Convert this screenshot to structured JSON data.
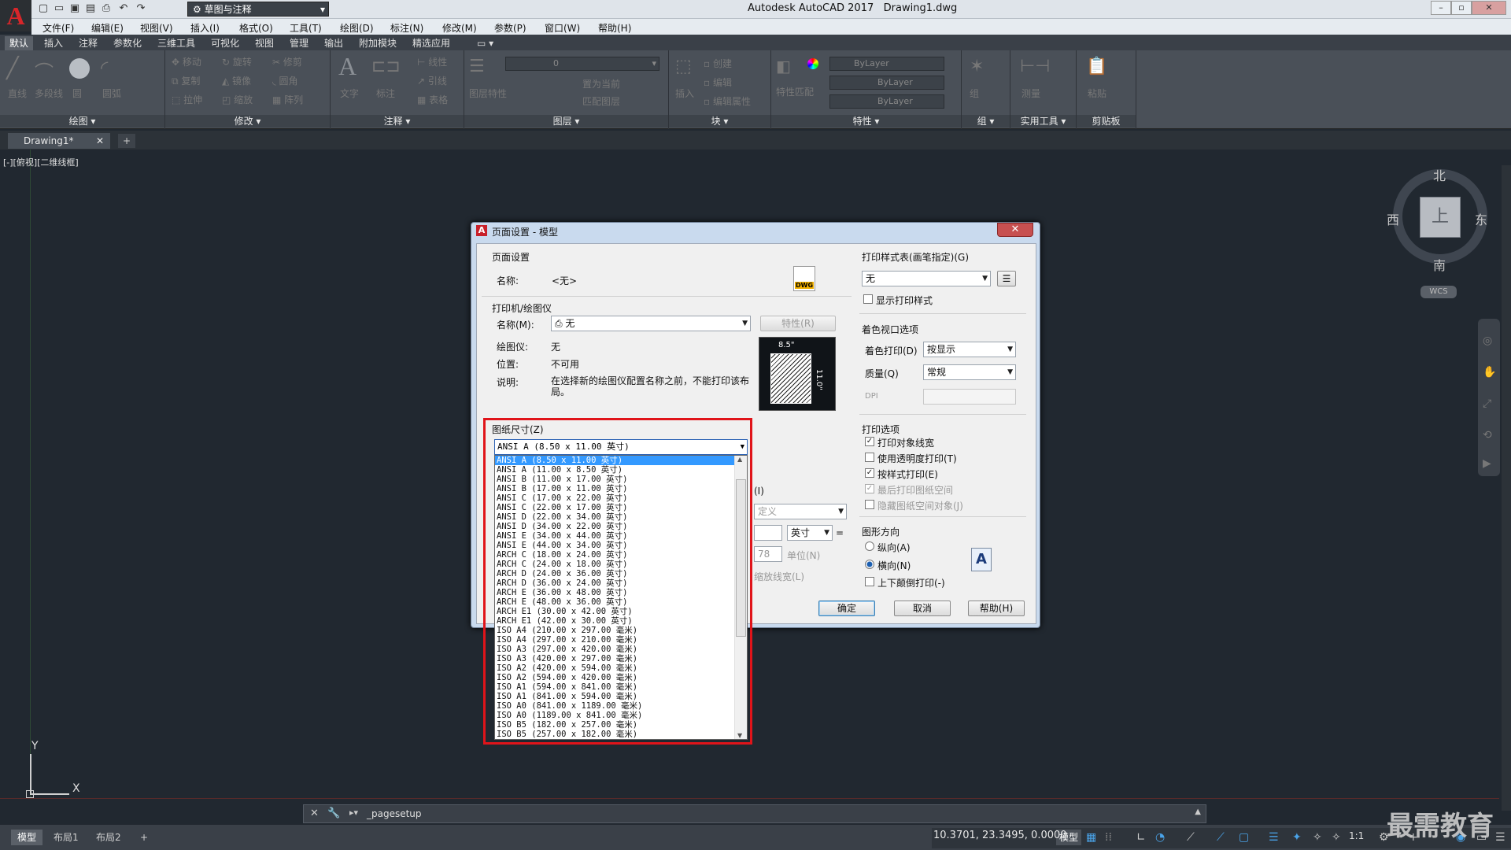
{
  "app": {
    "title": "Autodesk AutoCAD 2017",
    "filename": "Drawing1.dwg",
    "logo": "A",
    "workspace": "草图与注释"
  },
  "menus": [
    "文件(F)",
    "编辑(E)",
    "视图(V)",
    "插入(I)",
    "格式(O)",
    "工具(T)",
    "绘图(D)",
    "标注(N)",
    "修改(M)",
    "参数(P)",
    "窗口(W)",
    "帮助(H)"
  ],
  "ribbon_tabs": [
    "默认",
    "插入",
    "注释",
    "参数化",
    "三维工具",
    "可视化",
    "视图",
    "管理",
    "输出",
    "附加模块",
    "精选应用"
  ],
  "ribbon_groups": {
    "draw": {
      "label": "绘图 ▾",
      "items": [
        "直线",
        "多段线",
        "圆",
        "圆弧"
      ]
    },
    "modify": {
      "label": "修改 ▾",
      "items": [
        "移动",
        "旋转",
        "修剪",
        "复制",
        "镜像",
        "圆角",
        "拉伸",
        "缩放",
        "阵列"
      ]
    },
    "annotation": {
      "label": "注释 ▾",
      "items": [
        "文字",
        "标注",
        "线性",
        "引线",
        "表格"
      ]
    },
    "layers": {
      "label": "图层 ▾",
      "layer_value": "0",
      "items": [
        "图层特性",
        "置为当前",
        "匹配图层"
      ]
    },
    "block": {
      "label": "块 ▾",
      "items": [
        "插入",
        "创建",
        "编辑",
        "编辑属性"
      ]
    },
    "properties": {
      "label": "特性 ▾",
      "bylayer1": "ByLayer",
      "bylayer2": "ByLayer",
      "bylayer3": "ByLayer",
      "items": [
        "特性匹配"
      ]
    },
    "groups": {
      "label": "组 ▾",
      "items": [
        "组"
      ]
    },
    "utilities": {
      "label": "实用工具 ▾",
      "items": [
        "测量"
      ]
    },
    "clipboard": {
      "label": "剪贴板",
      "items": [
        "粘贴"
      ]
    }
  },
  "doc_tab": "Drawing1*",
  "viewport_label": "[-][俯视][二维线框]",
  "viewcube": {
    "north": "北",
    "south": "南",
    "east": "东",
    "west": "西",
    "face": "上",
    "wcs": "WCS"
  },
  "ucs": {
    "x": "X",
    "y": "Y"
  },
  "dialog": {
    "title": "页面设置 - 模型",
    "page_setup": {
      "heading": "页面设置",
      "name_label": "名称:",
      "name_value": "<无>",
      "dwg_icon": "DWG"
    },
    "printer": {
      "heading": "打印机/绘图仪",
      "name_label": "名称(M):",
      "name_value": "无",
      "properties_button": "特性(R)",
      "plotter_label": "绘图仪:",
      "plotter_value": "无",
      "location_label": "位置:",
      "location_value": "不可用",
      "description_label": "说明:",
      "description_value": "在选择新的绘图仪配置名称之前，不能打印该布局。",
      "preview_width": "8.5\"",
      "preview_height": "11.0\""
    },
    "paper_size": {
      "heading": "图纸尺寸(Z)",
      "selected": "ANSI A (8.50 x 11.00 英寸)",
      "options": [
        "ANSI A (8.50 x 11.00 英寸)",
        "ANSI A (11.00 x 8.50 英寸)",
        "ANSI B (11.00 x 17.00 英寸)",
        "ANSI B (17.00 x 11.00 英寸)",
        "ANSI C (17.00 x 22.00 英寸)",
        "ANSI C (22.00 x 17.00 英寸)",
        "ANSI D (22.00 x 34.00 英寸)",
        "ANSI D (34.00 x 22.00 英寸)",
        "ANSI E (34.00 x 44.00 英寸)",
        "ANSI E (44.00 x 34.00 英寸)",
        "ARCH C (18.00 x 24.00 英寸)",
        "ARCH C (24.00 x 18.00 英寸)",
        "ARCH D (24.00 x 36.00 英寸)",
        "ARCH D (36.00 x 24.00 英寸)",
        "ARCH E (36.00 x 48.00 英寸)",
        "ARCH E (48.00 x 36.00 英寸)",
        "ARCH E1 (30.00 x 42.00 英寸)",
        "ARCH E1 (42.00 x 30.00 英寸)",
        "ISO A4 (210.00 x 297.00 毫米)",
        "ISO A4 (297.00 x 210.00 毫米)",
        "ISO A3 (297.00 x 420.00 毫米)",
        "ISO A3 (420.00 x 297.00 毫米)",
        "ISO A2 (420.00 x 594.00 毫米)",
        "ISO A2 (594.00 x 420.00 毫米)",
        "ISO A1 (594.00 x 841.00 毫米)",
        "ISO A1 (841.00 x 594.00 毫米)",
        "ISO A0 (841.00 x 1189.00 毫米)",
        "ISO A0 (1189.00 x 841.00 毫米)",
        "ISO B5 (182.00 x 257.00 毫米)",
        "ISO B5 (257.00 x 182.00 毫米)"
      ]
    },
    "scale": {
      "partial_label": "(I)",
      "custom": "定义",
      "unit_value": "英寸",
      "equals": "=",
      "unit_label": "单位(N)",
      "num": "78",
      "lineweights": "缩放线宽(L)"
    },
    "plot_style": {
      "heading": "打印样式表(画笔指定)(G)",
      "value": "无",
      "show_styles": "显示打印样式"
    },
    "shaded": {
      "heading": "着色视口选项",
      "shade_label": "着色打印(D)",
      "shade_value": "按显示",
      "quality_label": "质量(Q)",
      "quality_value": "常规",
      "dpi_label": "DPI"
    },
    "plot_options": {
      "heading": "打印选项",
      "items": [
        {
          "label": "打印对象线宽",
          "checked": true
        },
        {
          "label": "使用透明度打印(T)",
          "checked": false
        },
        {
          "label": "按样式打印(E)",
          "checked": true
        },
        {
          "label": "最后打印图纸空间",
          "checked": true
        },
        {
          "label": "隐藏图纸空间对象(J)",
          "checked": false
        }
      ]
    },
    "orientation": {
      "heading": "图形方向",
      "portrait": "纵向(A)",
      "landscape": "横向(N)",
      "upside_down": "上下颠倒打印(-)",
      "icon": "A"
    },
    "buttons": {
      "ok": "确定",
      "cancel": "取消",
      "help": "帮助(H)"
    }
  },
  "command": {
    "prompt": "▸▾",
    "text": "_pagesetup"
  },
  "layout_tabs": [
    "模型",
    "布局1",
    "布局2",
    "+"
  ],
  "status": {
    "coords": "10.3701, 23.3495, 0.0000",
    "model": "模型",
    "scale": "1:1"
  },
  "watermark": "最需教育",
  "colors": {
    "accent": "#3399ff",
    "highlight_box": "#e0141a",
    "canvas": "#212830"
  }
}
